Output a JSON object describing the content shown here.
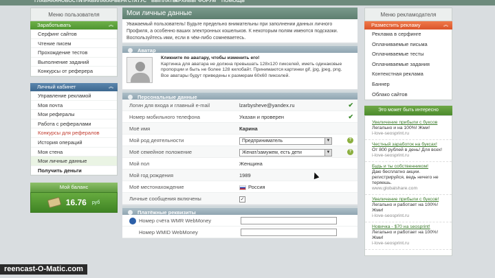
{
  "topnav": [
    "ГЛАВНАЯ",
    "НОВОСТИ",
    "ПРАВИЛА",
    "КАРЬЕРА",
    "СТАТУС",
    "ВЫПЛАТЫ",
    "АРХИВЫ",
    "ФОРУМ",
    "ПОМОЩЬ"
  ],
  "left": {
    "header": "Меню пользователя",
    "earn": {
      "title": "Заработывать",
      "items": [
        "Серфинг сайтов",
        "Чтение писем",
        "Прохождение тестов",
        "Выполнение заданий",
        "Конкурсы от реферера"
      ]
    },
    "cabinet": {
      "title": "Личный кабинет",
      "items": [
        "Управление рекламой",
        "Моя почта",
        "Мои рефералы",
        "Работа с рефералами",
        "Конкурсы для рефералов",
        "История операций",
        "Моя стена",
        "Мои личные данные",
        "Получить деньги"
      ]
    },
    "balance": {
      "title": "Мой баланс",
      "amount": "16.76",
      "currency": "руб"
    }
  },
  "center": {
    "title": "Мои личные данные",
    "intro": "Уважаемый пользователь! Будьте предельно внимательны при заполнении данных личного Профиля, а особенно ваших электронных кошельков. К некоторым полям имеются подсказки. Воспользуйтесь ими, если в чём-либо сомневаетесь.",
    "avatar_section": "Аватар",
    "avatar_title": "Кликните по аватару, чтобы изменить его!",
    "avatar_text": "Картинка для аватара не должна превышать 128x120 пикселей, иметь одинаковые пропорции и быть не более 128 килобайт. Принимаются картинки gif, jpg, jpeg, png. Все аватары будут приведены к размерам 60x60 пикселей.",
    "personal_section": "Персональные данные",
    "fields": [
      {
        "label": "Логин для входа и главный e-mail",
        "value": "lzarbysheve@yandex.ru"
      },
      {
        "label": "Номер мобильного телефона",
        "value": "Указан и проверен"
      },
      {
        "label": "Моё имя",
        "value": "Карина"
      },
      {
        "label": "Мой род деятельности",
        "value": "Предприниматель"
      },
      {
        "label": "Моё семейное положение",
        "value": "Женат/замужем, есть дети"
      },
      {
        "label": "Мой пол",
        "value": "Женщина"
      },
      {
        "label": "Мой год рождения",
        "value": "1989"
      },
      {
        "label": "Моё местонахождение",
        "value": "Россия"
      },
      {
        "label": "Личные сообщения включены",
        "value": "✓"
      }
    ],
    "payment_section": "Платёжные реквизиты",
    "wmr": "Номер счёта WMR WebMoney",
    "wmid": "Номер WMID WebMoney"
  },
  "right": {
    "header": "Меню рекламодателя",
    "bar": "Разместить рекламу",
    "items": [
      "Реклама в серфинге",
      "Оплачиваемые письма",
      "Оплачиваемые тесты",
      "Оплачиваемые задания",
      "Контекстная реклама",
      "Баннер",
      "Облако сайтов"
    ],
    "interest": "Это может быть интересно",
    "ads": [
      {
        "t": "Увеличение прибыли с буксов",
        "d": "Легально и на 100%! Жми!",
        "u": "i-love-seosprint.ru"
      },
      {
        "t": "Честный заработок на буксах!",
        "d": "От 800 рублей в день! Для всех!",
        "u": "i-love-seosprint.ru"
      },
      {
        "t": "Будь и ты собственником!",
        "d": "Даю бесплатно акции. регистрируйся, ведь ничего не теряешь.",
        "u": "www.globalshare.com"
      },
      {
        "t": "Увеличение прибыли с буксов!",
        "d": "Легально и работает на 100%! Жми!",
        "u": "i-love-seosprint.ru"
      },
      {
        "t": "Новичка - $70 на seosprint!",
        "d": "Легально и работает на 100%! Жми!",
        "u": "i-love-seosprint.ru"
      }
    ]
  },
  "watermark": "reencast-O-Matic.com"
}
